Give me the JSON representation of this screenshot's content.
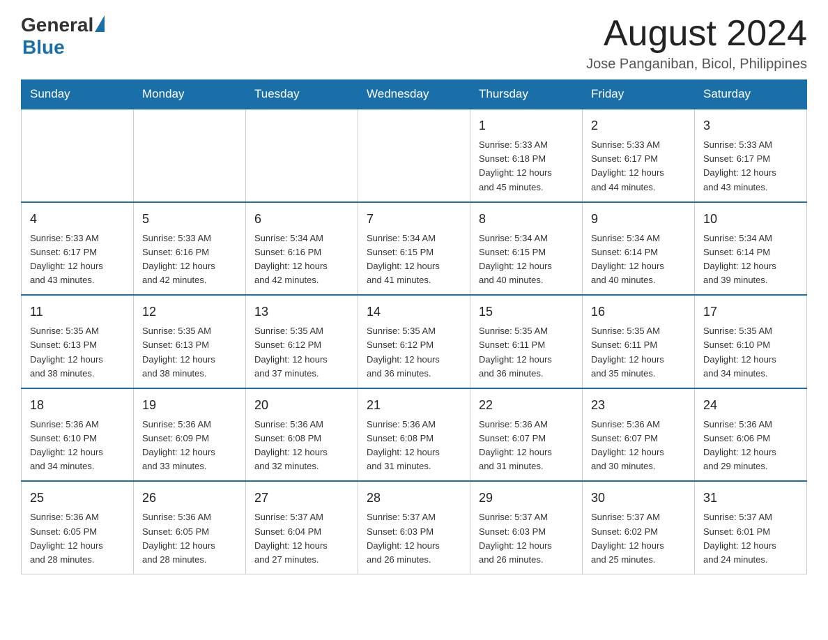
{
  "header": {
    "logo_general": "General",
    "logo_triangle": "▶",
    "logo_blue": "Blue",
    "month_year": "August 2024",
    "location": "Jose Panganiban, Bicol, Philippines"
  },
  "days_of_week": [
    "Sunday",
    "Monday",
    "Tuesday",
    "Wednesday",
    "Thursday",
    "Friday",
    "Saturday"
  ],
  "weeks": [
    [
      {
        "day": "",
        "info": ""
      },
      {
        "day": "",
        "info": ""
      },
      {
        "day": "",
        "info": ""
      },
      {
        "day": "",
        "info": ""
      },
      {
        "day": "1",
        "info": "Sunrise: 5:33 AM\nSunset: 6:18 PM\nDaylight: 12 hours\nand 45 minutes."
      },
      {
        "day": "2",
        "info": "Sunrise: 5:33 AM\nSunset: 6:17 PM\nDaylight: 12 hours\nand 44 minutes."
      },
      {
        "day": "3",
        "info": "Sunrise: 5:33 AM\nSunset: 6:17 PM\nDaylight: 12 hours\nand 43 minutes."
      }
    ],
    [
      {
        "day": "4",
        "info": "Sunrise: 5:33 AM\nSunset: 6:17 PM\nDaylight: 12 hours\nand 43 minutes."
      },
      {
        "day": "5",
        "info": "Sunrise: 5:33 AM\nSunset: 6:16 PM\nDaylight: 12 hours\nand 42 minutes."
      },
      {
        "day": "6",
        "info": "Sunrise: 5:34 AM\nSunset: 6:16 PM\nDaylight: 12 hours\nand 42 minutes."
      },
      {
        "day": "7",
        "info": "Sunrise: 5:34 AM\nSunset: 6:15 PM\nDaylight: 12 hours\nand 41 minutes."
      },
      {
        "day": "8",
        "info": "Sunrise: 5:34 AM\nSunset: 6:15 PM\nDaylight: 12 hours\nand 40 minutes."
      },
      {
        "day": "9",
        "info": "Sunrise: 5:34 AM\nSunset: 6:14 PM\nDaylight: 12 hours\nand 40 minutes."
      },
      {
        "day": "10",
        "info": "Sunrise: 5:34 AM\nSunset: 6:14 PM\nDaylight: 12 hours\nand 39 minutes."
      }
    ],
    [
      {
        "day": "11",
        "info": "Sunrise: 5:35 AM\nSunset: 6:13 PM\nDaylight: 12 hours\nand 38 minutes."
      },
      {
        "day": "12",
        "info": "Sunrise: 5:35 AM\nSunset: 6:13 PM\nDaylight: 12 hours\nand 38 minutes."
      },
      {
        "day": "13",
        "info": "Sunrise: 5:35 AM\nSunset: 6:12 PM\nDaylight: 12 hours\nand 37 minutes."
      },
      {
        "day": "14",
        "info": "Sunrise: 5:35 AM\nSunset: 6:12 PM\nDaylight: 12 hours\nand 36 minutes."
      },
      {
        "day": "15",
        "info": "Sunrise: 5:35 AM\nSunset: 6:11 PM\nDaylight: 12 hours\nand 36 minutes."
      },
      {
        "day": "16",
        "info": "Sunrise: 5:35 AM\nSunset: 6:11 PM\nDaylight: 12 hours\nand 35 minutes."
      },
      {
        "day": "17",
        "info": "Sunrise: 5:35 AM\nSunset: 6:10 PM\nDaylight: 12 hours\nand 34 minutes."
      }
    ],
    [
      {
        "day": "18",
        "info": "Sunrise: 5:36 AM\nSunset: 6:10 PM\nDaylight: 12 hours\nand 34 minutes."
      },
      {
        "day": "19",
        "info": "Sunrise: 5:36 AM\nSunset: 6:09 PM\nDaylight: 12 hours\nand 33 minutes."
      },
      {
        "day": "20",
        "info": "Sunrise: 5:36 AM\nSunset: 6:08 PM\nDaylight: 12 hours\nand 32 minutes."
      },
      {
        "day": "21",
        "info": "Sunrise: 5:36 AM\nSunset: 6:08 PM\nDaylight: 12 hours\nand 31 minutes."
      },
      {
        "day": "22",
        "info": "Sunrise: 5:36 AM\nSunset: 6:07 PM\nDaylight: 12 hours\nand 31 minutes."
      },
      {
        "day": "23",
        "info": "Sunrise: 5:36 AM\nSunset: 6:07 PM\nDaylight: 12 hours\nand 30 minutes."
      },
      {
        "day": "24",
        "info": "Sunrise: 5:36 AM\nSunset: 6:06 PM\nDaylight: 12 hours\nand 29 minutes."
      }
    ],
    [
      {
        "day": "25",
        "info": "Sunrise: 5:36 AM\nSunset: 6:05 PM\nDaylight: 12 hours\nand 28 minutes."
      },
      {
        "day": "26",
        "info": "Sunrise: 5:36 AM\nSunset: 6:05 PM\nDaylight: 12 hours\nand 28 minutes."
      },
      {
        "day": "27",
        "info": "Sunrise: 5:37 AM\nSunset: 6:04 PM\nDaylight: 12 hours\nand 27 minutes."
      },
      {
        "day": "28",
        "info": "Sunrise: 5:37 AM\nSunset: 6:03 PM\nDaylight: 12 hours\nand 26 minutes."
      },
      {
        "day": "29",
        "info": "Sunrise: 5:37 AM\nSunset: 6:03 PM\nDaylight: 12 hours\nand 26 minutes."
      },
      {
        "day": "30",
        "info": "Sunrise: 5:37 AM\nSunset: 6:02 PM\nDaylight: 12 hours\nand 25 minutes."
      },
      {
        "day": "31",
        "info": "Sunrise: 5:37 AM\nSunset: 6:01 PM\nDaylight: 12 hours\nand 24 minutes."
      }
    ]
  ]
}
